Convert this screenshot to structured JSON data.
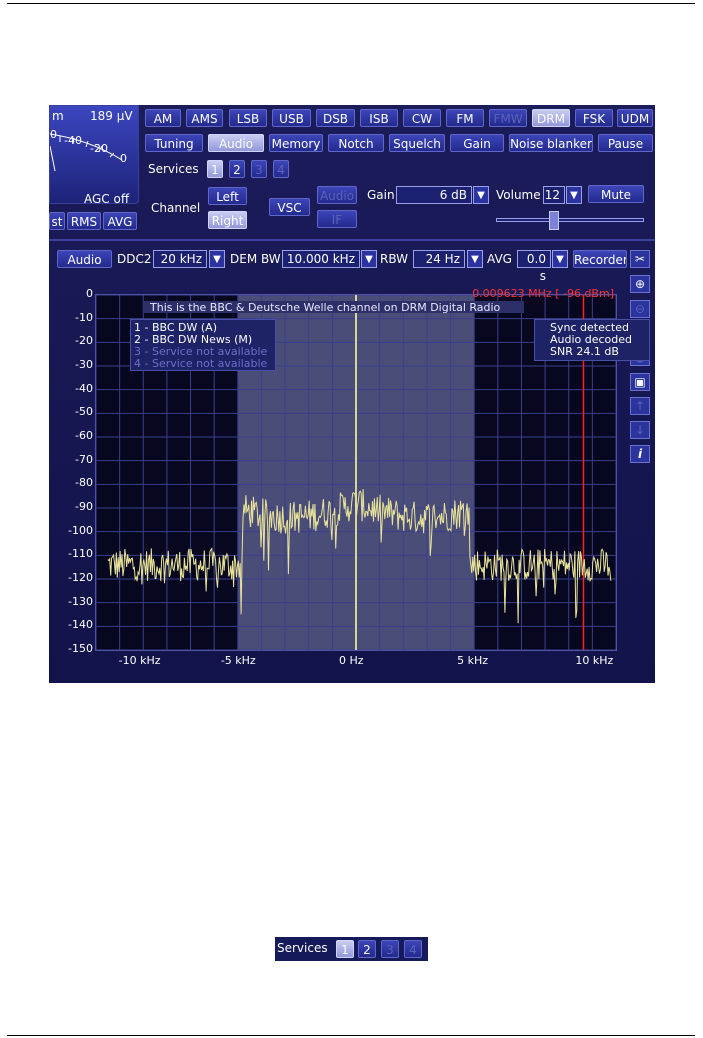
{
  "modes": [
    "AM",
    "AMS",
    "LSB",
    "USB",
    "DSB",
    "ISB",
    "CW",
    "FM",
    "FMW",
    "DRM",
    "FSK",
    "UDM"
  ],
  "tabs": [
    "Tuning",
    "Audio",
    "Memory",
    "Notch",
    "Squelch",
    "Gain",
    "Noise blanker",
    "Pause"
  ],
  "meter": {
    "unit_left": "m",
    "value": "189 µV",
    "scale": [
      "0",
      "-40",
      "-20",
      "0"
    ],
    "agc": "AGC off",
    "cut_label": "st",
    "rms": "RMS",
    "avg": "AVG"
  },
  "services": {
    "label": "Services",
    "items": [
      "1",
      "2",
      "3",
      "4"
    ]
  },
  "channel": {
    "label": "Channel",
    "left": "Left",
    "right": "Right",
    "vsc": "VSC",
    "audio_btn": "Audio",
    "if_btn": "IF"
  },
  "gain": {
    "label": "Gain",
    "value": "6 dB"
  },
  "volume": {
    "label": "Volume",
    "value": "12",
    "mute": "Mute",
    "level": 0.39
  },
  "toolbar": {
    "audio": "Audio",
    "ddc2_label": "DDC2",
    "ddc2": "20 kHz",
    "dembw_label": "DEM BW",
    "dembw": "10.000 kHz",
    "rbw_label": "RBW",
    "rbw": "24 Hz",
    "avg_label": "AVG",
    "avg": "0.0 s",
    "recorder": "Recorder"
  },
  "spectrum": {
    "marker_readout": "0.009623 MHz [  -96 dBm]",
    "channel_title": "This is the BBC & Deutsche Welle channel on DRM Digital Radio",
    "services": [
      {
        "text": "1 - BBC  DW (A)",
        "active": true
      },
      {
        "text": "2 - BBC  DW News (M)",
        "active": true
      },
      {
        "text": "3 - Service not available",
        "active": false
      },
      {
        "text": "4 - Service not available",
        "active": false
      }
    ],
    "status": [
      "Sync detected",
      "Audio decoded",
      "SNR    24.1 dB"
    ],
    "y_ticks": [
      "0",
      "-10",
      "-20",
      "-30",
      "-40",
      "-50",
      "-60",
      "-70",
      "-80",
      "-90",
      "-100",
      "-110",
      "-120",
      "-130",
      "-140",
      "-150"
    ],
    "x_ticks": [
      "-10 kHz",
      "-5 kHz",
      "0 Hz",
      "5 kHz",
      "10 kHz"
    ],
    "colors": {
      "trace": "#e9e39a",
      "passband": "#4a4d78",
      "marker": "#ff2020",
      "center": "#d8d49a"
    }
  },
  "tools": [
    "scissors-icon",
    "zoom-in-icon",
    "zoom-out-icon",
    "zoom-fit-icon",
    "record-icon",
    "save-icon",
    "up-arrow-icon",
    "down-arrow-icon",
    "info-icon"
  ],
  "mini": {
    "label": "Services",
    "items": [
      "1",
      "2",
      "3",
      "4"
    ]
  }
}
